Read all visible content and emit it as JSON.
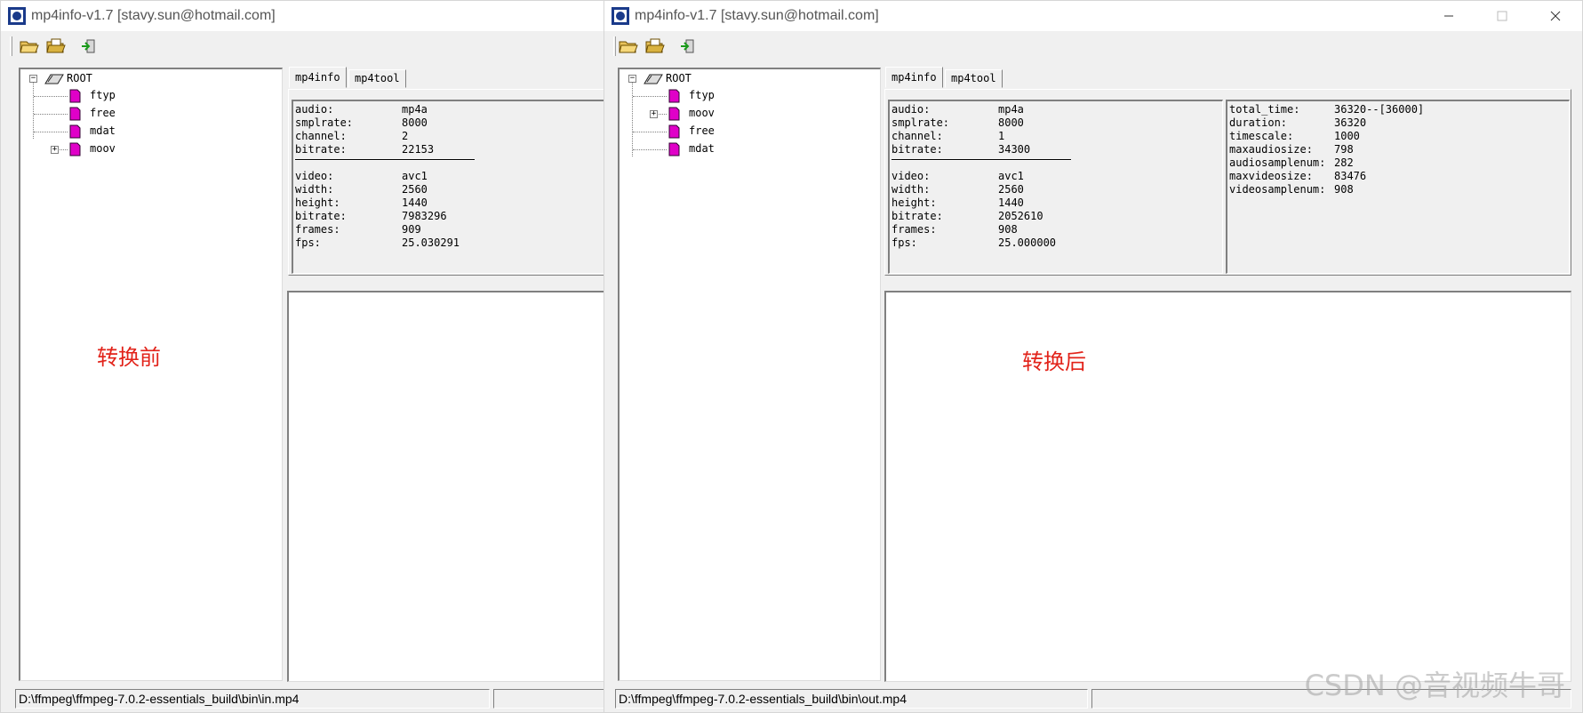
{
  "left_window": {
    "title": "mp4info-v1.7 [stavy.sun@hotmail.com]",
    "tree": {
      "root_label": "ROOT",
      "items": [
        {
          "label": "ftyp",
          "expandable": false
        },
        {
          "label": "free",
          "expandable": false
        },
        {
          "label": "mdat",
          "expandable": false
        },
        {
          "label": "moov",
          "expandable": true
        }
      ]
    },
    "tabs": [
      "mp4info",
      "mp4tool"
    ],
    "audio": [
      {
        "key": "audio:",
        "value": "mp4a"
      },
      {
        "key": "smplrate:",
        "value": "8000"
      },
      {
        "key": "channel:",
        "value": "2"
      },
      {
        "key": "bitrate:",
        "value": "22153"
      }
    ],
    "video": [
      {
        "key": "video:",
        "value": "avc1"
      },
      {
        "key": "width:",
        "value": "2560"
      },
      {
        "key": "height:",
        "value": "1440"
      },
      {
        "key": "bitrate:",
        "value": "7983296"
      },
      {
        "key": "frames:",
        "value": "909"
      },
      {
        "key": "fps:",
        "value": "25.030291"
      }
    ],
    "annotation": "转换前",
    "status_path": "D:\\ffmpeg\\ffmpeg-7.0.2-essentials_build\\bin\\in.mp4"
  },
  "right_window": {
    "title": "mp4info-v1.7 [stavy.sun@hotmail.com]",
    "tree": {
      "root_label": "ROOT",
      "items": [
        {
          "label": "ftyp",
          "expandable": false
        },
        {
          "label": "moov",
          "expandable": true
        },
        {
          "label": "free",
          "expandable": false
        },
        {
          "label": "mdat",
          "expandable": false
        }
      ]
    },
    "tabs": [
      "mp4info",
      "mp4tool"
    ],
    "audio": [
      {
        "key": "audio:",
        "value": "mp4a"
      },
      {
        "key": "smplrate:",
        "value": "8000"
      },
      {
        "key": "channel:",
        "value": "1"
      },
      {
        "key": "bitrate:",
        "value": "34300"
      }
    ],
    "video": [
      {
        "key": "video:",
        "value": "avc1"
      },
      {
        "key": "width:",
        "value": "2560"
      },
      {
        "key": "height:",
        "value": "1440"
      },
      {
        "key": "bitrate:",
        "value": "2052610"
      },
      {
        "key": "frames:",
        "value": "908"
      },
      {
        "key": "fps:",
        "value": "25.000000"
      }
    ],
    "extra": [
      {
        "key": "total_time:",
        "value": "36320--[36000]"
      },
      {
        "key": "duration:",
        "value": "36320"
      },
      {
        "key": "timescale:",
        "value": "1000"
      },
      {
        "key": "maxaudiosize:",
        "value": "798"
      },
      {
        "key": "audiosamplenum:",
        "value": "282"
      },
      {
        "key": "maxvideosize:",
        "value": "83476"
      },
      {
        "key": "videosamplenum:",
        "value": "908"
      }
    ],
    "annotation": "转换后",
    "status_path": "D:\\ffmpeg\\ffmpeg-7.0.2-essentials_build\\bin\\out.mp4"
  },
  "toolbar_icons": [
    "open-folder-icon",
    "open-folder-alt-icon",
    "exit-icon"
  ],
  "watermark": "CSDN @音视频牛哥",
  "colors": {
    "annotation": "#e2231a",
    "atom_icon": "#e000c8"
  }
}
